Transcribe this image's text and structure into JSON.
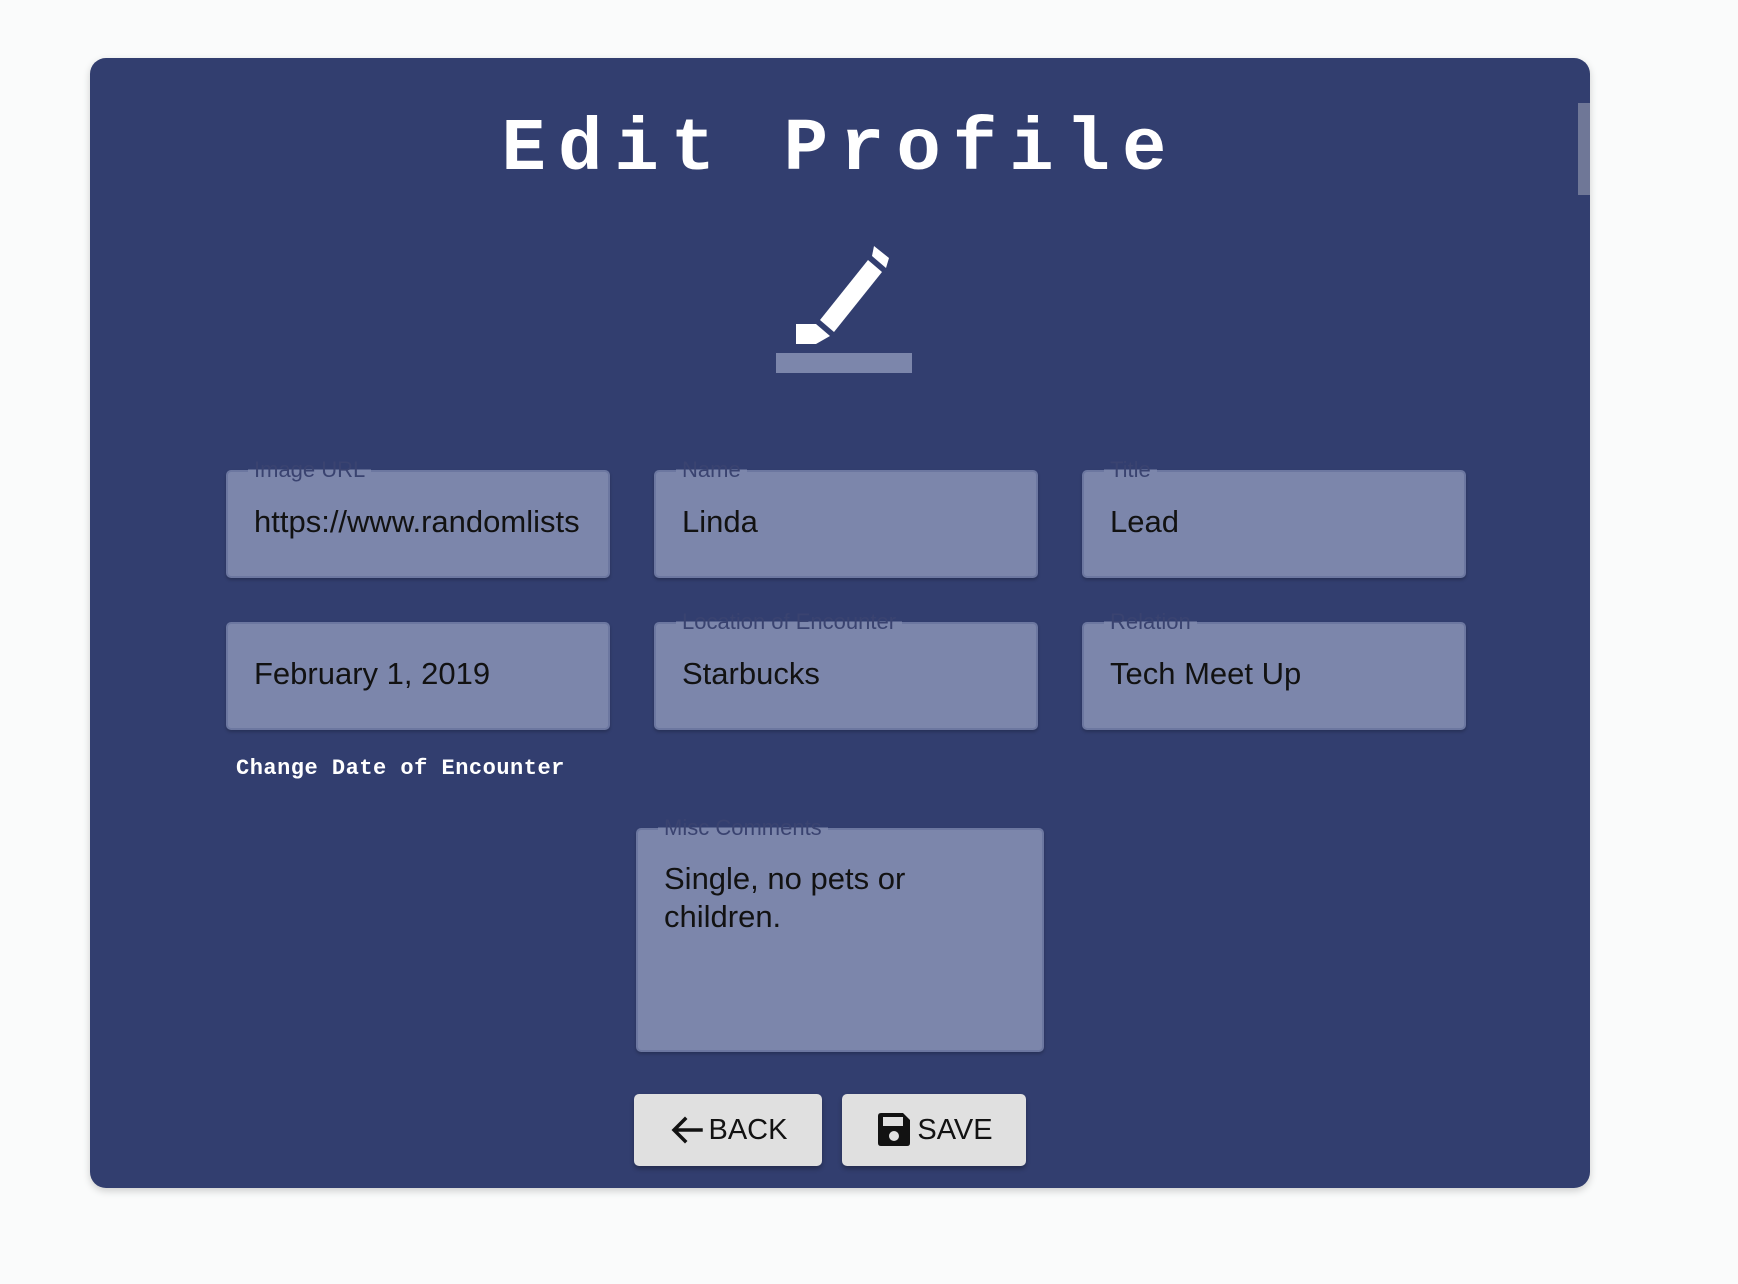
{
  "page": {
    "title": "Edit Profile"
  },
  "fields": {
    "image_url": {
      "label": "Image URL",
      "value": "https://www.randomlists.com"
    },
    "name": {
      "label": "Name",
      "value": "Linda"
    },
    "title": {
      "label": "Title",
      "value": "Lead"
    },
    "date": {
      "value": "February 1, 2019"
    },
    "location": {
      "label": "Location of Encounter",
      "value": "Starbucks"
    },
    "relation": {
      "label": "Relation",
      "value": "Tech Meet Up"
    },
    "misc": {
      "label": "Misc Comments",
      "value": "Single, no pets or children."
    }
  },
  "change_date_label": "Change Date of Encounter",
  "buttons": {
    "back": "BACK",
    "save": "SAVE"
  },
  "icons": {
    "header": "edit-pencil-icon",
    "back": "arrow-left-icon",
    "save": "floppy-disk-icon"
  },
  "colors": {
    "card_background": "#323e6f",
    "field_background": "#7c86ab",
    "button_background": "#e0e0e0",
    "title_text": "#ffffff"
  }
}
